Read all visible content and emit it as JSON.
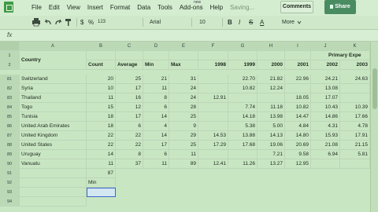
{
  "menu": {
    "items": [
      "File",
      "Edit",
      "View",
      "Insert",
      "Format",
      "Data",
      "Tools",
      "Add-ons",
      "Help"
    ],
    "status": "Saving...",
    "addons_badge": "new"
  },
  "header_buttons": {
    "comments": "Comments",
    "share": "Share"
  },
  "toolbar": {
    "icons": [
      "printer-icon",
      "undo-icon",
      "redo-icon",
      "paint-format-icon"
    ],
    "currency": "$",
    "percent": "%",
    "decimals": "123",
    "font": "Arial",
    "font_size": "10",
    "bold": "B",
    "italic": "I",
    "strike": "S",
    "text_color": "A",
    "more": "More"
  },
  "formula_bar": {
    "label": "fx",
    "value": ""
  },
  "columns": [
    "A",
    "B",
    "C",
    "D",
    "E",
    "F",
    "G",
    "H",
    "I",
    "J",
    "K"
  ],
  "header_row1_label": "1",
  "header_row2_label": "2",
  "header": {
    "country": "Country",
    "count": "Count",
    "average": "Average",
    "min": "Min",
    "max": "Max",
    "years": [
      "1998",
      "1999",
      "2000",
      "2001",
      "2002",
      "2003"
    ],
    "primary_exp": "Primary Expe"
  },
  "rows": [
    {
      "n": "81",
      "country": "Switzerland",
      "count": "20",
      "avg": "25",
      "min": "21",
      "max": "31",
      "y1998": "",
      "y1999": "22.70",
      "y2000": "21.82",
      "y2001": "22.96",
      "y2002": "24.21",
      "y2003": "24.63"
    },
    {
      "n": "82",
      "country": "Syria",
      "count": "10",
      "avg": "17",
      "min": "11",
      "max": "24",
      "y1998": "",
      "y1999": "10.82",
      "y2000": "12.24",
      "y2001": "",
      "y2002": "13.08",
      "y2003": ""
    },
    {
      "n": "83",
      "country": "Thailand",
      "count": "11",
      "avg": "16",
      "min": "8",
      "max": "24",
      "y1998": "12.91",
      "y1999": "",
      "y2000": "",
      "y2001": "18.05",
      "y2002": "17.07",
      "y2003": ""
    },
    {
      "n": "84",
      "country": "Togo",
      "count": "15",
      "avg": "12",
      "min": "6",
      "max": "28",
      "y1998": "",
      "y1999": "7.74",
      "y2000": "11.18",
      "y2001": "10.82",
      "y2002": "10.43",
      "y2003": "10.39"
    },
    {
      "n": "85",
      "country": "Tunisia",
      "count": "18",
      "avg": "17",
      "min": "14",
      "max": "25",
      "y1998": "",
      "y1999": "14.18",
      "y2000": "13.98",
      "y2001": "14.47",
      "y2002": "14.86",
      "y2003": "17.66"
    },
    {
      "n": "86",
      "country": "United Arab Emirates",
      "count": "18",
      "avg": "6",
      "min": "4",
      "max": "9",
      "y1998": "",
      "y1999": "5.38",
      "y2000": "5.00",
      "y2001": "4.84",
      "y2002": "4.31",
      "y2003": "4.78"
    },
    {
      "n": "87",
      "country": "United Kingdom",
      "count": "22",
      "avg": "22",
      "min": "14",
      "max": "29",
      "y1998": "14.53",
      "y1999": "13.88",
      "y2000": "14.13",
      "y2001": "14.80",
      "y2002": "15.93",
      "y2003": "17.91"
    },
    {
      "n": "88",
      "country": "United States",
      "count": "22",
      "avg": "22",
      "min": "17",
      "max": "25",
      "y1998": "17.29",
      "y1999": "17.68",
      "y2000": "19.06",
      "y2001": "20.69",
      "y2002": "21.08",
      "y2003": "21.15"
    },
    {
      "n": "89",
      "country": "Uruguay",
      "count": "14",
      "avg": "8",
      "min": "6",
      "max": "11",
      "y1998": "",
      "y1999": "",
      "y2000": "7.21",
      "y2001": "9.58",
      "y2002": "6.94",
      "y2003": "5.81"
    },
    {
      "n": "90",
      "country": "Vanuatu",
      "count": "11",
      "avg": "37",
      "min": "11",
      "max": "89",
      "y1998": "12.41",
      "y1999": "11.26",
      "y2000": "13.27",
      "y2001": "12.95",
      "y2002": "",
      "y2003": ""
    }
  ],
  "extra": {
    "row91_label": "91",
    "row92_label": "92",
    "row93_label": "93",
    "row94_label": "94",
    "count_total": "87",
    "min_label": "Min"
  },
  "colors": {
    "accent": "#4a8c62",
    "selection": "#3a66c8",
    "background": "#c9e6c3"
  }
}
